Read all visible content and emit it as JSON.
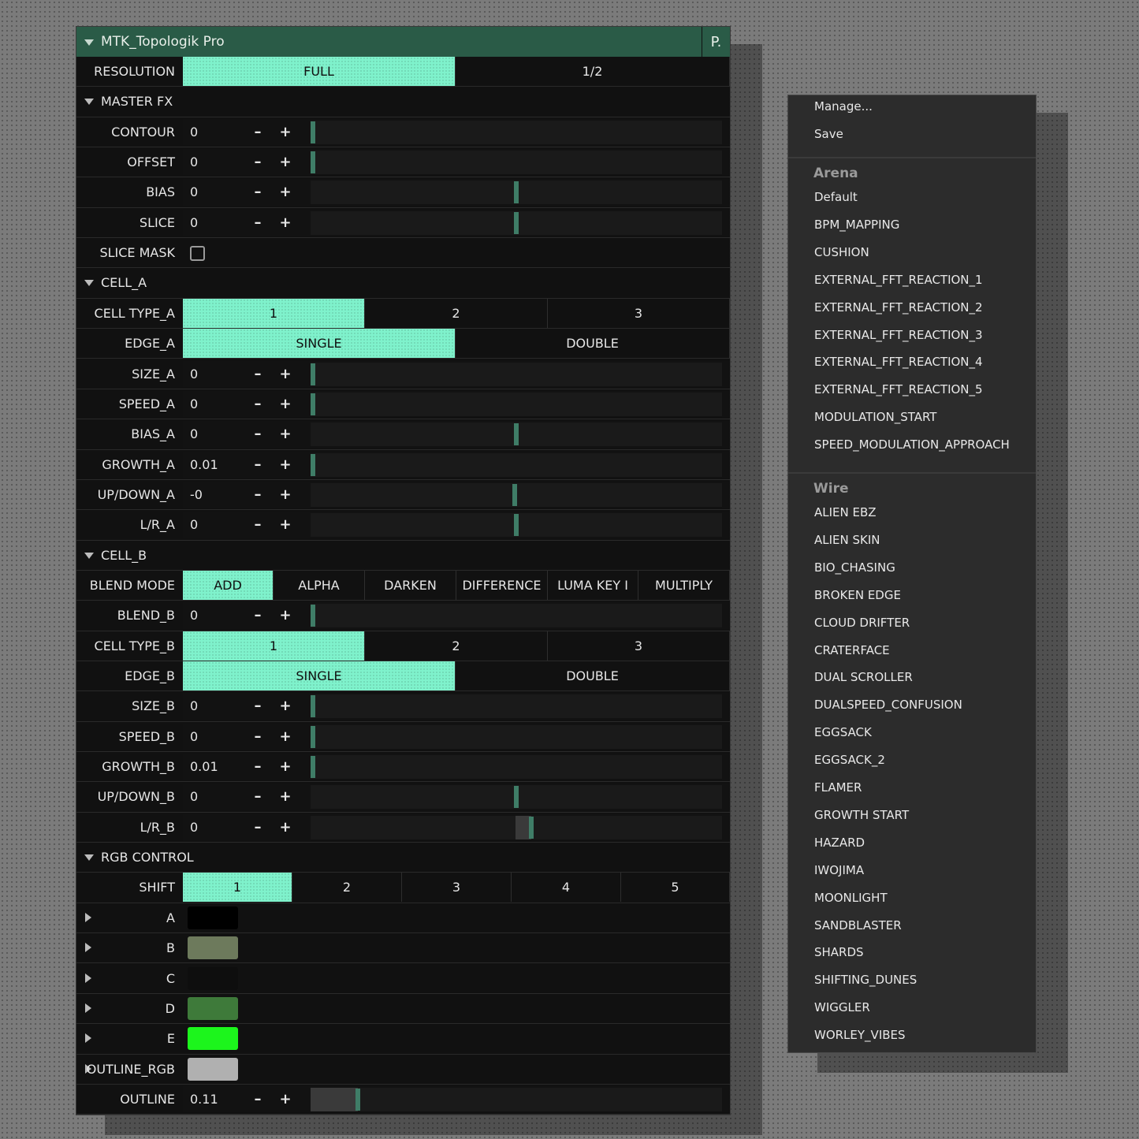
{
  "panel": {
    "title": "MTK_Topologik Pro",
    "corner_button": "P.",
    "resolution": {
      "label": "RESOLUTION",
      "options": [
        "FULL",
        "1/2"
      ],
      "selected": "FULL"
    },
    "master_fx": {
      "title": "MASTER FX",
      "contour": {
        "label": "CONTOUR",
        "value": "0"
      },
      "offset": {
        "label": "OFFSET",
        "value": "0"
      },
      "bias": {
        "label": "BIAS",
        "value": "0"
      },
      "slice": {
        "label": "SLICE",
        "value": "0"
      },
      "slice_mask": {
        "label": "SLICE MASK",
        "checked": false
      }
    },
    "cell_a": {
      "title": "CELL_A",
      "cell_type": {
        "label": "CELL TYPE_A",
        "options": [
          "1",
          "2",
          "3"
        ],
        "selected": "1"
      },
      "edge": {
        "label": "EDGE_A",
        "options": [
          "SINGLE",
          "DOUBLE"
        ],
        "selected": "SINGLE"
      },
      "size": {
        "label": "SIZE_A",
        "value": "0"
      },
      "speed": {
        "label": "SPEED_A",
        "value": "0"
      },
      "bias": {
        "label": "BIAS_A",
        "value": "0"
      },
      "growth": {
        "label": "GROWTH_A",
        "value": "0.01"
      },
      "updown": {
        "label": "UP/DOWN_A",
        "value": "-0"
      },
      "lr": {
        "label": "L/R_A",
        "value": "0"
      }
    },
    "cell_b": {
      "title": "CELL_B",
      "blend_mode": {
        "label": "BLEND MODE",
        "options": [
          "ADD",
          "ALPHA",
          "DARKEN",
          "DIFFERENCE",
          "LUMA KEY I",
          "MULTIPLY"
        ],
        "selected": "ADD"
      },
      "blend": {
        "label": "BLEND_B",
        "value": "0"
      },
      "cell_type": {
        "label": "CELL TYPE_B",
        "options": [
          "1",
          "2",
          "3"
        ],
        "selected": "1"
      },
      "edge": {
        "label": "EDGE_B",
        "options": [
          "SINGLE",
          "DOUBLE"
        ],
        "selected": "SINGLE"
      },
      "size": {
        "label": "SIZE_B",
        "value": "0"
      },
      "speed": {
        "label": "SPEED_B",
        "value": "0"
      },
      "growth": {
        "label": "GROWTH_B",
        "value": "0.01"
      },
      "updown": {
        "label": "UP/DOWN_B",
        "value": "0"
      },
      "lr": {
        "label": "L/R_B",
        "value": "0"
      }
    },
    "rgb_control": {
      "title": "RGB CONTROL",
      "shift": {
        "label": "SHIFT",
        "options": [
          "1",
          "2",
          "3",
          "4",
          "5"
        ],
        "selected": "1"
      },
      "colors": [
        {
          "label": "A",
          "color": "#000000"
        },
        {
          "label": "B",
          "color": "#6d7a5c"
        },
        {
          "label": "C",
          "color": "#0e0e0e"
        },
        {
          "label": "D",
          "color": "#3e7a3a"
        },
        {
          "label": "E",
          "color": "#1cf51c"
        },
        {
          "label": "OUTLINE_RGB",
          "color": "#b0b0b0"
        }
      ],
      "outline": {
        "label": "OUTLINE",
        "value": "0.11"
      }
    },
    "minus_glyph": "–",
    "plus_glyph": "+"
  },
  "preset_menu": {
    "actions": [
      "Manage...",
      "Save"
    ],
    "groups": [
      {
        "title": "Arena",
        "items": [
          "Default",
          "BPM_MAPPING",
          "CUSHION",
          "EXTERNAL_FFT_REACTION_1",
          "EXTERNAL_FFT_REACTION_2",
          "EXTERNAL_FFT_REACTION_3",
          "EXTERNAL_FFT_REACTION_4",
          "EXTERNAL_FFT_REACTION_5",
          "MODULATION_START",
          "SPEED_MODULATION_APPROACH"
        ]
      },
      {
        "title": "Wire",
        "items": [
          "ALIEN EBZ",
          "ALIEN SKIN",
          "BIO_CHASING",
          "BROKEN EDGE",
          "CLOUD DRIFTER",
          "CRATERFACE",
          "DUAL SCROLLER",
          "DUALSPEED_CONFUSION",
          "EGGSACK",
          "EGGSACK_2",
          "FLAMER",
          "GROWTH START",
          "HAZARD",
          "IWOJIMA",
          "MOONLIGHT",
          "SANDBLASTER",
          "SHARDS",
          "SHIFTING_DUNES",
          "WIGGLER",
          "WORLEY_VIBES"
        ]
      }
    ]
  },
  "colors": {
    "accent": "#7ff2cc",
    "title_bar": "#2a5b47",
    "slider_thumb": "#3f7d67",
    "panel_bg": "#111111",
    "menu_bg": "#2c2c2c"
  },
  "icons": {
    "collapse": "triangle-down-icon",
    "expand": "triangle-right-icon"
  }
}
